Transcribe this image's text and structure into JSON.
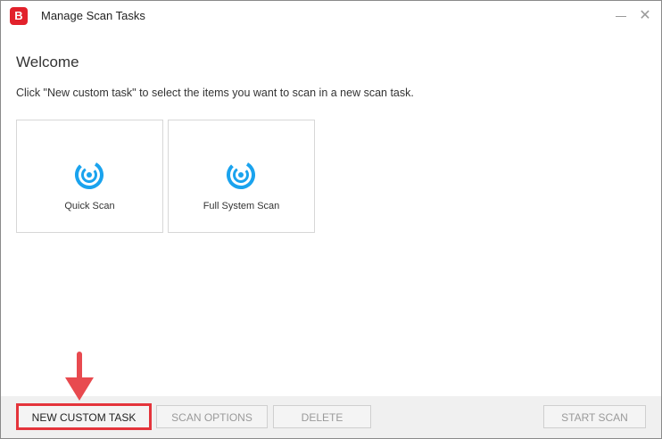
{
  "window": {
    "logo_letter": "B",
    "title": "Manage Scan Tasks"
  },
  "content": {
    "heading": "Welcome",
    "description": "Click \"New custom task\" to select the items you want to scan in a new scan task."
  },
  "tasks": [
    {
      "label": "Quick Scan",
      "icon": "scan-icon"
    },
    {
      "label": "Full System Scan",
      "icon": "scan-icon"
    }
  ],
  "footer": {
    "new_custom_task": "NEW CUSTOM TASK",
    "scan_options": "SCAN OPTIONS",
    "delete": "DELETE",
    "start_scan": "START SCAN"
  },
  "colors": {
    "brand": "#e2212b",
    "scan_icon": "#1aa3ee",
    "highlight": "#e4343b"
  }
}
